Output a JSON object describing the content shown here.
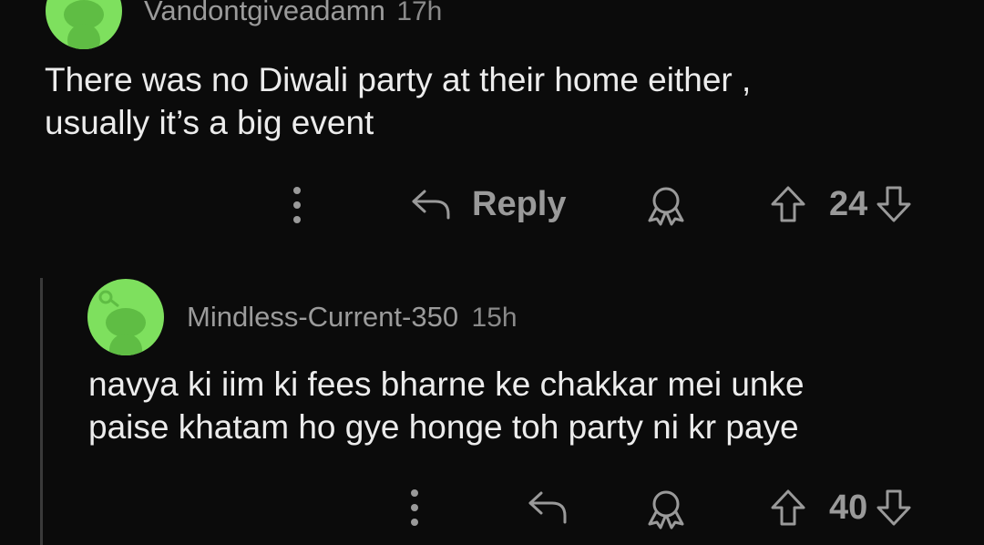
{
  "comments": [
    {
      "username": "Vandontgiveadamn",
      "time": "17h",
      "body_lines": [
        "There was no Diwali party at their home either ,",
        "usually it’s a big event"
      ],
      "reply_label": "Reply",
      "votes": "24"
    },
    {
      "username": "Mindless-Current-350",
      "time": "15h",
      "body_lines": [
        "navya ki iim ki fees bharne ke chakkar mei unke",
        "paise khatam ho gye honge toh party ni kr paye"
      ],
      "votes": "40"
    }
  ],
  "icons": [
    "avatar-snoo-icon",
    "more-options-icon",
    "reply-arrow-icon",
    "award-icon",
    "upvote-icon",
    "downvote-icon"
  ],
  "colors": {
    "background": "#0b0b0b",
    "avatar": "#7ee05e",
    "muted": "#9a9a9a",
    "text": "#ececec"
  }
}
